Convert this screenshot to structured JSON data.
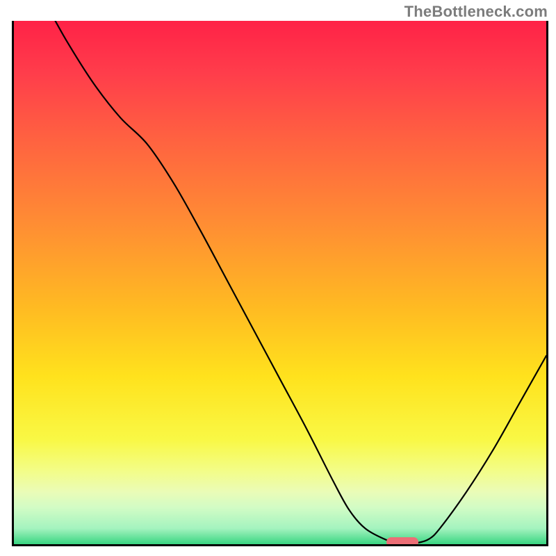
{
  "watermark": "TheBottleneck.com",
  "colors": {
    "axis": "#000000",
    "curve": "#000000",
    "marker": "#ec6e76",
    "gradient_top": "#ff2247",
    "gradient_bottom": "#39d581"
  },
  "chart_data": {
    "type": "line",
    "title": "",
    "xlabel": "",
    "ylabel": "",
    "xlim": [
      0,
      100
    ],
    "ylim": [
      0,
      100
    ],
    "x": [
      0,
      5,
      10,
      15,
      20,
      25,
      30,
      35,
      40,
      45,
      50,
      55,
      60,
      63,
      66,
      70,
      72,
      74,
      76,
      78,
      80,
      85,
      90,
      95,
      100
    ],
    "values": [
      113,
      105,
      96,
      88,
      81.5,
      76.5,
      69,
      60,
      50.5,
      41,
      31.5,
      22,
      12,
      6.5,
      3,
      0.8,
      0.4,
      0.3,
      0.3,
      1,
      3,
      10,
      18,
      27,
      36
    ],
    "sweet_spot": {
      "x_start": 70,
      "x_end": 76,
      "y": 0.4
    },
    "note": "Values are the vertical distance from the bottom axis as a percent of plot height; curve exits above the top border at x≈0."
  }
}
